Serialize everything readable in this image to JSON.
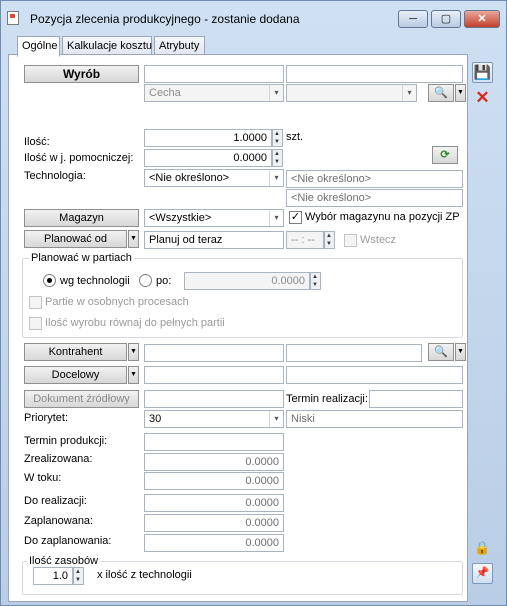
{
  "window": {
    "title": "Pozycja zlecenia produkcyjnego - zostanie dodana",
    "min_label": "─",
    "max_label": "▢",
    "close_label": "✕"
  },
  "tabs": [
    {
      "label": "Ogólne"
    },
    {
      "label": "Kalkulacje kosztu"
    },
    {
      "label": "Atrybuty"
    }
  ],
  "form": {
    "wyrob_label": "Wyrób",
    "wyrob_code": "",
    "wyrob_name": "",
    "cecha_placeholder": "Cecha",
    "ilosc_label": "Ilość:",
    "ilosc_value": "1.0000",
    "ilosc_unit": "szt.",
    "ilosc_pom_label": "Ilość w j. pomocniczej:",
    "ilosc_pom_value": "0.0000",
    "technologia_label": "Technologia:",
    "technologia_value": "<Nie określono>",
    "technologia_info1": "<Nie określono>",
    "technologia_info2": "<Nie określono>",
    "magazyn_label": "Magazyn",
    "magazyn_value": "<Wszystkie>",
    "wybor_magazynu_label": "Wybór magazynu na pozycji ZP",
    "wybor_magazynu_checked": "✓",
    "planowac_od_label": "Planować od",
    "planowac_od_value": "Planuj od teraz",
    "time_value": "-- : --",
    "wstecz_label": "Wstecz",
    "planowac_partie_title": "Planować w partiach",
    "wg_technologii_label": "wg technologii",
    "po_label": "po:",
    "po_value": "0.0000",
    "partie_procesy_label": "Partie w osobnych procesach",
    "ilosc_rowna_label": "Ilość wyrobu równaj do pełnych partii",
    "kontrahent_label": "Kontrahent",
    "kontrahent_code": "",
    "kontrahent_name": "",
    "docelowy_label": "Docelowy",
    "docelowy_code": "",
    "docelowy_name": "",
    "dokument_zrodlowy_label": "Dokument źródłowy",
    "dokument_zrodlowy_value": "",
    "termin_realizacji_label": "Termin realizacji:",
    "termin_realizacji_value": "",
    "priorytet_label": "Priorytet:",
    "priorytet_value": "30",
    "priorytet_desc": "Niski",
    "termin_produkcji_label": "Termin produkcji:",
    "termin_produkcji_value": "",
    "zrealizowana_label": "Zrealizowana:",
    "zrealizowana_value": "0.0000",
    "w_toku_label": "W toku:",
    "w_toku_value": "0.0000",
    "do_realizacji_label": "Do realizacji:",
    "do_realizacji_value": "0.0000",
    "zaplanowana_label": "Zaplanowana:",
    "zaplanowana_value": "0.0000",
    "do_zaplanowania_label": "Do zaplanowania:",
    "do_zaplanowania_value": "0.0000",
    "ilosc_zasobow_title": "Ilość zasobów",
    "ilosc_zasobow_value": "1.0",
    "ilosc_zasobow_suffix": "x ilość z technologii"
  },
  "icons": {
    "drop": "▼",
    "combo": "▾",
    "magnifier": "🔍",
    "refresh": "⟳",
    "save": "💾",
    "delete": "✕",
    "lock": "🔒",
    "pin": "📌"
  },
  "colors": {
    "accent": "#3a6ea5",
    "delete": "#d92a1c"
  }
}
